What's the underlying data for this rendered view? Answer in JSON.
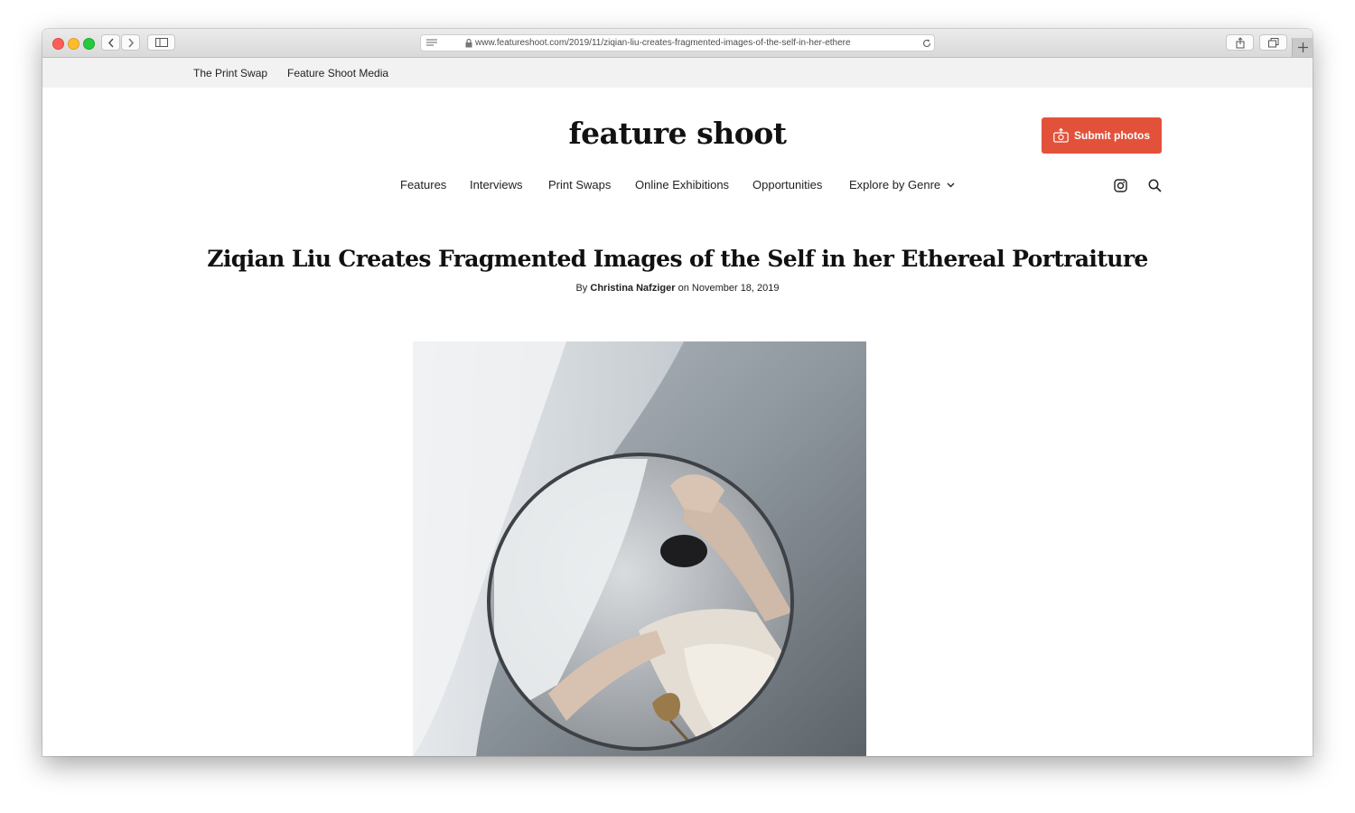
{
  "browser": {
    "url": "www.featureshoot.com/2019/11/ziqian-liu-creates-fragmented-images-of-the-self-in-her-ethere",
    "icons": [
      "back-icon",
      "forward-icon",
      "sidebar-icon",
      "reader-icon",
      "lock-icon",
      "reload-icon",
      "share-icon",
      "tabs-icon",
      "new-tab-icon"
    ]
  },
  "topbar": {
    "links": [
      "The Print Swap",
      "Feature Shoot Media"
    ]
  },
  "site": {
    "logo": "feature shoot",
    "submit_label": "Submit photos",
    "accent_color": "#e2523b"
  },
  "nav": {
    "items": [
      "Features",
      "Interviews",
      "Print Swaps",
      "Online Exhibitions",
      "Opportunities",
      "Explore by Genre"
    ],
    "icons": [
      "chevron-down-icon",
      "instagram-icon",
      "search-icon"
    ]
  },
  "article": {
    "title": "Ziqian Liu Creates Fragmented Images of the Self in her Ethereal Portraiture",
    "by_prefix": "By",
    "author": "Christina Nafziger",
    "date_prefix": "on",
    "date": "November 18, 2019"
  }
}
